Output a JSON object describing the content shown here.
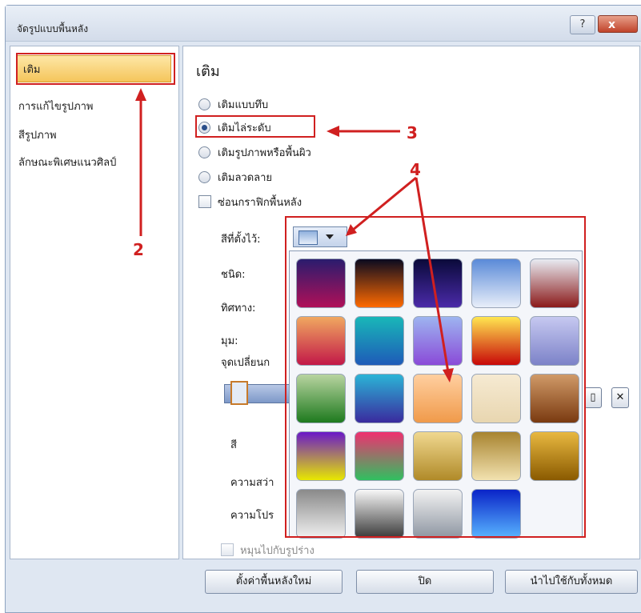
{
  "dialog": {
    "title": "จัดรูปแบบพื้นหลัง",
    "help_label": "?",
    "close_label": "x"
  },
  "sidebar": {
    "items": [
      {
        "label": "เติม",
        "selected": true
      },
      {
        "label": "การแก้ไขรูปภาพ"
      },
      {
        "label": "สีรูปภาพ"
      },
      {
        "label": "ลักษณะพิเศษแนวศิลป์"
      }
    ]
  },
  "main": {
    "heading": "เติม",
    "fill_options": [
      {
        "label": "เติมแบบทึบ",
        "selected": false
      },
      {
        "label": "เติมไล่ระดับ",
        "selected": true
      },
      {
        "label": "เติมรูปภาพหรือพื้นผิว",
        "selected": false
      },
      {
        "label": "เติมลวดลาย",
        "selected": false
      }
    ],
    "hide_graphics_label": "ซ่อนกราฟิกพื้นหลัง",
    "preset_colors_label": "สีที่ตั้งไว้:",
    "type_label": "ชนิด:",
    "direction_label": "ทิศทาง:",
    "angle_label": "มุม:",
    "stops_label": "จุดเปลี่ยนก",
    "color_label": "สี",
    "brightness_label": "ความสว่า",
    "transparency_label": "ความโปร",
    "rotate_label": "หมุนไปกับรูปร่าง"
  },
  "buttons": {
    "reset": "ตั้งค่าพื้นหลังใหม่",
    "close": "ปิด",
    "apply_all": "นำไปใช้กับทั้งหมด"
  },
  "annotations": [
    "2",
    "3",
    "4"
  ],
  "gradient_tiles": [
    [
      "#2a1c6e",
      "#b01058"
    ],
    [
      "#0a0a20",
      "#ff6a00"
    ],
    [
      "#0a0a3a",
      "#4a2aa8"
    ],
    [
      "#5a8ad8",
      "#e8eef9"
    ],
    [
      "#e8ebf2",
      "#8b1a1a"
    ],
    [
      "#f0a860",
      "#c21848"
    ],
    [
      "#19b7b8",
      "#1e5ab8"
    ],
    [
      "#9db4f0",
      "#8a4ad8"
    ],
    [
      "#ffe650",
      "#c80808"
    ],
    [
      "#c6c8f0",
      "#7c82c8"
    ],
    [
      "#b8d4a0",
      "#1e7a1e"
    ],
    [
      "#2bb4d6",
      "#3a2a9e"
    ],
    [
      "#ffcfa0",
      "#f09a4a"
    ],
    [
      "#f6ead2",
      "#e8d6b0"
    ],
    [
      "#d09a68",
      "#7a3a10"
    ],
    [
      "#6a18c8",
      "#e8e800"
    ],
    [
      "#f03070",
      "#30c060"
    ],
    [
      "#f0d890",
      "#b08a28"
    ],
    [
      "#a88430",
      "#f2e2b0"
    ],
    [
      "#e8b840",
      "#8a5a00"
    ],
    [
      "#8a8a8a",
      "#f0f0f0"
    ],
    [
      "#f8f8f8",
      "#3a3a3a"
    ],
    [
      "#f2f2f2",
      "#8e96a2"
    ],
    [
      "#0a24c8",
      "#58b4ff"
    ]
  ]
}
